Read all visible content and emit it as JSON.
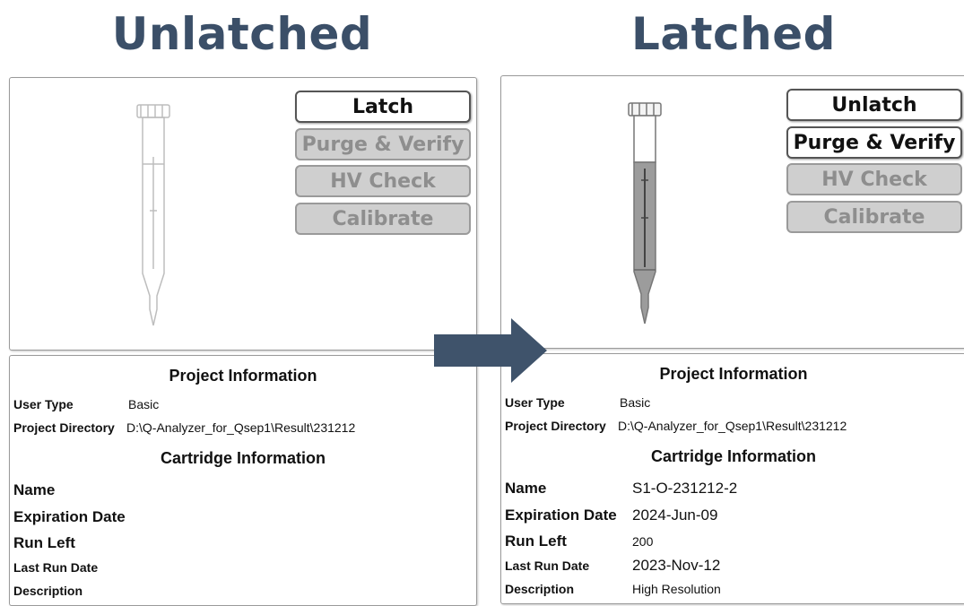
{
  "headings": {
    "left": "Unlatched",
    "right": "Latched"
  },
  "colors": {
    "heading": "#3b4f68",
    "arrow": "#3f536b",
    "disabled_button": "#cfcfcf"
  },
  "left": {
    "buttons": {
      "latch": "Latch",
      "purge": "Purge & Verify",
      "hv": "HV Check",
      "calibrate": "Calibrate"
    },
    "project": {
      "title": "Project Information",
      "user_type_label": "User Type",
      "user_type_value": "Basic",
      "dir_label": "Project Directory",
      "dir_value": "D:\\Q-Analyzer_for_Qsep1\\Result\\231212"
    },
    "cartridge": {
      "title": "Cartridge Information",
      "name_label": "Name",
      "name_value": "",
      "exp_label": "Expiration Date",
      "exp_value": "",
      "run_label": "Run Left",
      "run_value": "",
      "last_label": "Last Run Date",
      "last_value": "",
      "desc_label": "Description",
      "desc_value": ""
    }
  },
  "right": {
    "buttons": {
      "unlatch": "Unlatch",
      "purge": "Purge & Verify",
      "hv": "HV Check",
      "calibrate": "Calibrate"
    },
    "project": {
      "title": "Project Information",
      "user_type_label": "User Type",
      "user_type_value": "Basic",
      "dir_label": "Project Directory",
      "dir_value": "D:\\Q-Analyzer_for_Qsep1\\Result\\231212"
    },
    "cartridge": {
      "title": "Cartridge Information",
      "name_label": "Name",
      "name_value": "S1-O-231212-2",
      "exp_label": "Expiration Date",
      "exp_value": "2024-Jun-09",
      "run_label": "Run Left",
      "run_value": "200",
      "last_label": "Last Run Date",
      "last_value": "2023-Nov-12",
      "desc_label": "Description",
      "desc_value": "High Resolution"
    }
  }
}
